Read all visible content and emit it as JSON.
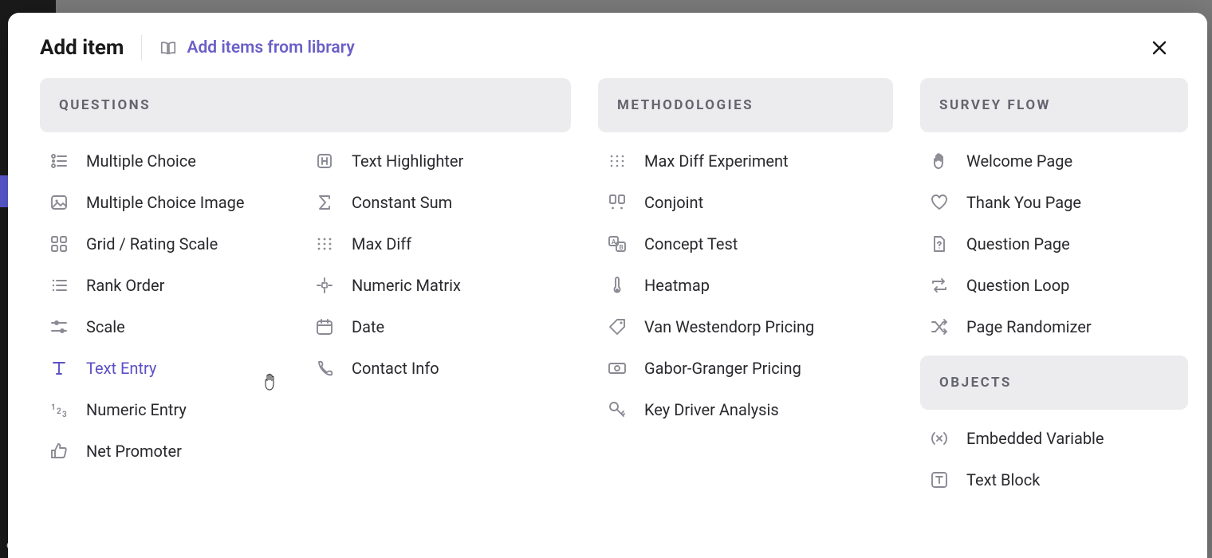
{
  "modal": {
    "title": "Add item",
    "library_link": "Add items from library"
  },
  "sections": {
    "questions": {
      "header": "QUESTIONS"
    },
    "methodologies": {
      "header": "METHODOLOGIES"
    },
    "survey_flow": {
      "header": "SURVEY FLOW"
    },
    "objects": {
      "header": "OBJECTS"
    }
  },
  "questions_col1": [
    {
      "label": "Multiple Choice"
    },
    {
      "label": "Multiple Choice Image"
    },
    {
      "label": "Grid / Rating Scale"
    },
    {
      "label": "Rank Order"
    },
    {
      "label": "Scale"
    },
    {
      "label": "Text Entry",
      "active": true
    },
    {
      "label": "Numeric Entry"
    },
    {
      "label": "Net Promoter"
    }
  ],
  "questions_col2": [
    {
      "label": "Text Highlighter"
    },
    {
      "label": "Constant Sum"
    },
    {
      "label": "Max Diff"
    },
    {
      "label": "Numeric Matrix"
    },
    {
      "label": "Date"
    },
    {
      "label": "Contact Info"
    }
  ],
  "methodologies": [
    {
      "label": "Max Diff Experiment"
    },
    {
      "label": "Conjoint"
    },
    {
      "label": "Concept Test"
    },
    {
      "label": "Heatmap"
    },
    {
      "label": "Van Westendorp Pricing"
    },
    {
      "label": "Gabor-Granger Pricing"
    },
    {
      "label": "Key Driver Analysis"
    }
  ],
  "survey_flow": [
    {
      "label": "Welcome Page"
    },
    {
      "label": "Thank You Page"
    },
    {
      "label": "Question Page"
    },
    {
      "label": "Question Loop"
    },
    {
      "label": "Page Randomizer"
    }
  ],
  "objects": [
    {
      "label": "Embedded Variable"
    },
    {
      "label": "Text Block"
    }
  ]
}
